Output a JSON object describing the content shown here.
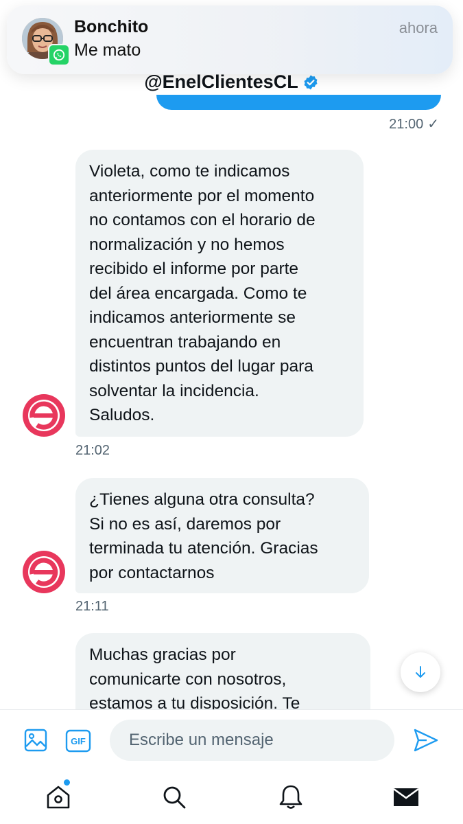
{
  "notification": {
    "sender": "Bonchito",
    "message": "Me mato",
    "time": "ahora",
    "app_icon": "whatsapp-icon"
  },
  "chat": {
    "title": "@EnelClientesCL",
    "verified_icon": "verified-badge-icon",
    "last_sent_time": "21:00",
    "sent_status_icon": "checkmark-icon"
  },
  "messages": [
    {
      "text": "Violeta, como te indicamos\nanteriormente por el momento\nno contamos con el horario de\nnormalización y no hemos\nrecibido el informe por parte\ndel área encargada. Como te\nindicamos anteriormente se\nencuentran trabajando en\ndistintos puntos del lugar para\nsolventar la incidencia.\nSaludos.",
      "time": "21:02"
    },
    {
      "text": "¿Tienes alguna otra consulta?\nSi no es así, daremos por\nterminada tu atención. Gracias\npor contactarnos",
      "time": "21:11"
    },
    {
      "text": "Muchas gracias por\ncomunicarte con nosotros,\nestamos a tu disposición. Te",
      "time": ""
    }
  ],
  "composer": {
    "placeholder": "Escribe un mensaje",
    "gif_label": "GIF"
  },
  "colors": {
    "accent": "#1d9bf0",
    "bubble": "#eff3f4",
    "enel_pink": "#e8375c",
    "whatsapp": "#25d366"
  },
  "tabs": [
    "home-icon",
    "search-icon",
    "bell-icon",
    "mail-icon"
  ]
}
